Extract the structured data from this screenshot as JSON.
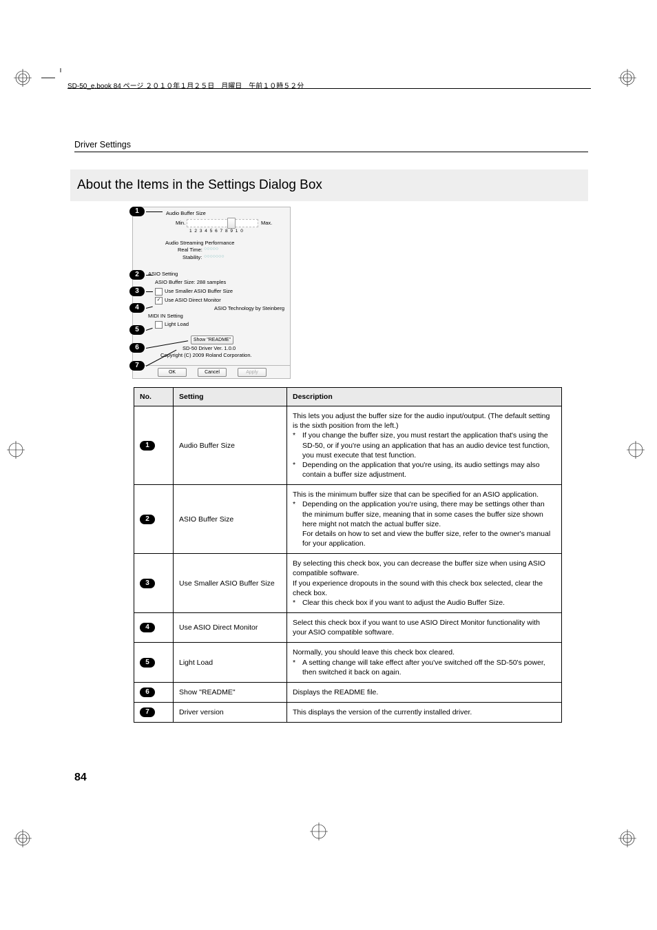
{
  "header_line": "SD-50_e.book  84 ページ  ２０１０年１月２５日　月曜日　午前１０時５２分",
  "running_head": "Driver Settings",
  "section_title": "About the Items in the Settings Dialog Box",
  "page_number": "84",
  "dialog": {
    "audio_buffer_label": "Audio Buffer Size",
    "min": "Min.",
    "max": "Max.",
    "ticks": [
      "1",
      "2",
      "3",
      "4",
      "5",
      "6",
      "7",
      "8",
      "9",
      "10"
    ],
    "aspe_label": "Audio Streaming Performance",
    "realtime_label": "Real Time:",
    "realtime_val": "○○○○○",
    "stability_label": "Stability:",
    "stability_val": "○○○○○○○",
    "asio_setting": "ASIO Setting",
    "asio_buf": "ASIO Buffer Size:  288 samples",
    "chk_small": "Use Smaller ASIO Buffer Size",
    "chk_adm": "Use ASIO Direct Monitor",
    "asio_tech": "ASIO Technology by Steinberg",
    "midi_in": "MIDI IN Setting",
    "light_load": "Light Load",
    "show_readme": "Show \"README\"",
    "driver_ver": "SD-50 Driver Ver. 1.0.0",
    "copyright": "Copyright (C) 2009 Roland Corporation.",
    "ok": "OK",
    "cancel": "Cancel",
    "apply": "Apply"
  },
  "callouts": [
    "1",
    "2",
    "3",
    "4",
    "5",
    "6",
    "7"
  ],
  "table": {
    "headers": {
      "no": "No.",
      "setting": "Setting",
      "desc": "Description"
    },
    "rows": [
      {
        "no": "1",
        "setting": "Audio Buffer Size",
        "desc_intro": "This lets you adjust the buffer size for the audio input/output. (The default setting is the sixth position from the left.)",
        "bullets": [
          "If you change the buffer size, you must restart the application that's using the SD-50, or if you're using an application that has an audio device test function, you must execute that test function.",
          "Depending on the application that you're using, its audio settings may also contain a buffer size adjustment."
        ]
      },
      {
        "no": "2",
        "setting": "ASIO Buffer Size",
        "desc_intro": "This is the minimum buffer size that can be specified for an ASIO application.",
        "bullets": [
          "Depending on the application you're using, there may be settings other than the minimum buffer size, meaning that in some cases the buffer size shown here might not match the actual buffer size.\nFor details on how to set and view the buffer size, refer to the owner's manual for your application."
        ]
      },
      {
        "no": "3",
        "setting": "Use Smaller ASIO Buffer Size",
        "desc_intro": "By selecting this check box, you can decrease the buffer size when using ASIO compatible software.\nIf you experience dropouts in the sound with this check box selected, clear the check box.",
        "bullets": [
          "Clear this check box if you want to adjust the Audio Buffer Size."
        ]
      },
      {
        "no": "4",
        "setting": "Use ASIO Direct Monitor",
        "desc_intro": "Select this check box if you want to use ASIO Direct Monitor functionality with your ASIO compatible software.",
        "bullets": []
      },
      {
        "no": "5",
        "setting": "Light Load",
        "desc_intro": "Normally, you should leave this check box cleared.",
        "bullets": [
          "A setting change will take effect after you've switched off the SD-50's power, then switched it back on again."
        ]
      },
      {
        "no": "6",
        "setting": "Show \"README\"",
        "desc_intro": "Displays the README file.",
        "bullets": []
      },
      {
        "no": "7",
        "setting": "Driver version",
        "desc_intro": "This displays the version of the currently installed driver.",
        "bullets": []
      }
    ]
  }
}
